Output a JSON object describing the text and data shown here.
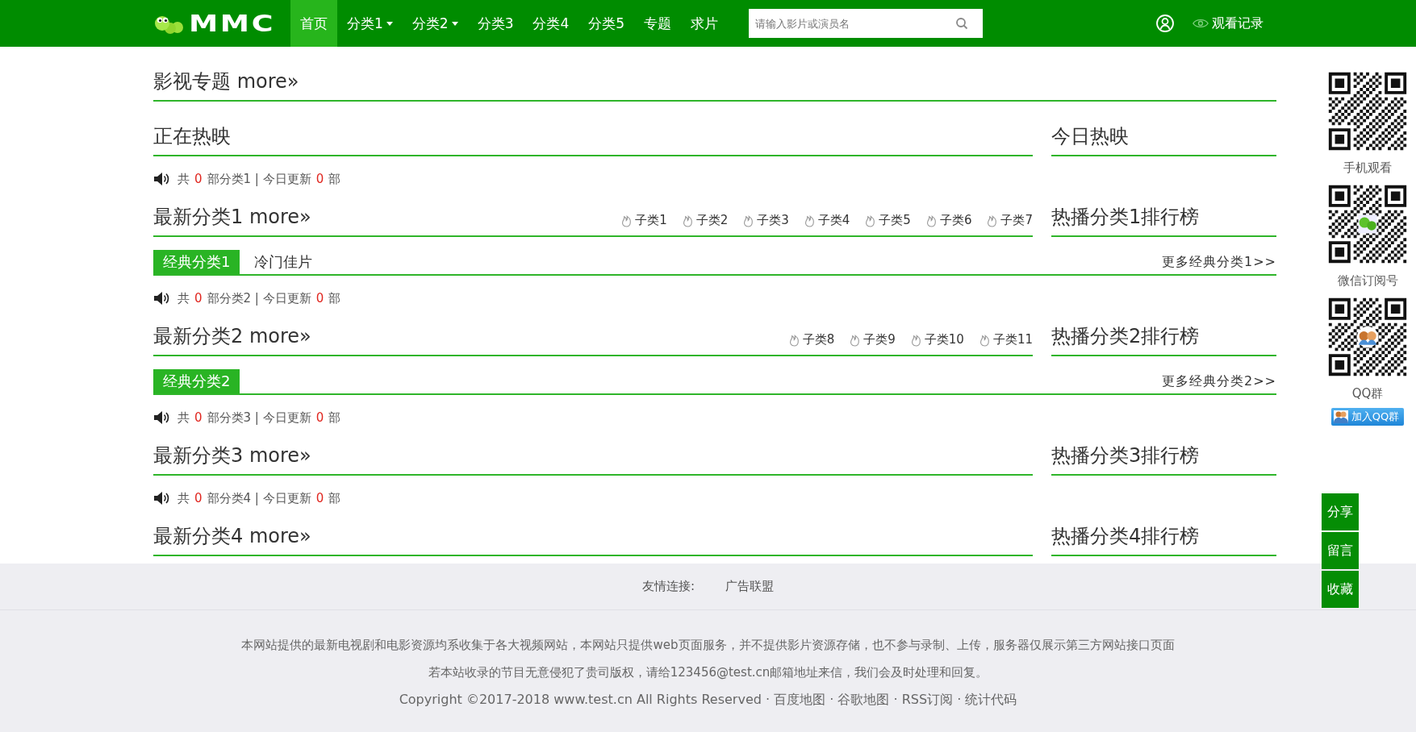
{
  "header": {
    "logo_text": "MMC",
    "nav": [
      {
        "label": "首页",
        "selected": true,
        "dropdown": false
      },
      {
        "label": "分类1",
        "selected": false,
        "dropdown": true
      },
      {
        "label": "分类2",
        "selected": false,
        "dropdown": true
      },
      {
        "label": "分类3",
        "selected": false,
        "dropdown": false
      },
      {
        "label": "分类4",
        "selected": false,
        "dropdown": false
      },
      {
        "label": "分类5",
        "selected": false,
        "dropdown": false
      },
      {
        "label": "专题",
        "selected": false,
        "dropdown": false
      },
      {
        "label": "求片",
        "selected": false,
        "dropdown": false
      }
    ],
    "search": {
      "placeholder": "请输入影片或演员名"
    },
    "history": "观看记录"
  },
  "topic": {
    "title": "影视专题 more»"
  },
  "now_showing": {
    "title": "正在热映",
    "side_title": "今日热映"
  },
  "categories": [
    {
      "stats": [
        {
          "kind": "text",
          "text": "共"
        },
        {
          "kind": "count",
          "text": "0"
        },
        {
          "kind": "text",
          "text": "部分类1 | 今日更新"
        },
        {
          "kind": "count",
          "text": "0"
        },
        {
          "kind": "text",
          "text": "部"
        }
      ],
      "title": "最新分类1 more»",
      "subcategories": [
        "子类1",
        "子类2",
        "子类3",
        "子类4",
        "子类5",
        "子类6",
        "子类7"
      ],
      "ranking_title": "热播分类1排行榜",
      "classic": {
        "tabs": [
          {
            "label": "经典分类1",
            "selected": true
          },
          {
            "label": "冷门佳片",
            "selected": false
          }
        ],
        "more": "更多经典分类1>>"
      }
    },
    {
      "stats": [
        {
          "kind": "text",
          "text": "共"
        },
        {
          "kind": "count",
          "text": "0"
        },
        {
          "kind": "text",
          "text": "部分类2 | 今日更新"
        },
        {
          "kind": "count",
          "text": "0"
        },
        {
          "kind": "text",
          "text": "部"
        }
      ],
      "title": "最新分类2 more»",
      "subcategories": [
        "子类8",
        "子类9",
        "子类10",
        "子类11"
      ],
      "ranking_title": "热播分类2排行榜",
      "classic": {
        "tabs": [
          {
            "label": "经典分类2",
            "selected": true
          }
        ],
        "more": "更多经典分类2>>"
      }
    },
    {
      "stats": [
        {
          "kind": "text",
          "text": "共"
        },
        {
          "kind": "count",
          "text": "0"
        },
        {
          "kind": "text",
          "text": "部分类3 | 今日更新"
        },
        {
          "kind": "count",
          "text": "0"
        },
        {
          "kind": "text",
          "text": "部"
        }
      ],
      "title": "最新分类3 more»",
      "ranking_title": "热播分类3排行榜"
    },
    {
      "stats": [
        {
          "kind": "text",
          "text": "共"
        },
        {
          "kind": "count",
          "text": "0"
        },
        {
          "kind": "text",
          "text": "部分类4 | 今日更新"
        },
        {
          "kind": "count",
          "text": "0"
        },
        {
          "kind": "text",
          "text": "部"
        }
      ],
      "title": "最新分类4 more»",
      "ranking_title": "热播分类4排行榜"
    }
  ],
  "side": {
    "qr_codes": [
      {
        "kind": "plain",
        "caption": "手机观看"
      },
      {
        "kind": "worm",
        "caption": "微信订阅号"
      },
      {
        "kind": "people",
        "caption": "QQ群"
      }
    ],
    "join_button": "加入QQ群",
    "float_buttons": [
      "分享",
      "留言",
      "收藏"
    ]
  },
  "footer": {
    "links_label": "友情连接:",
    "links": [
      "广告联盟"
    ],
    "notice": [
      "本网站提供的最新电视剧和电影资源均系收集于各大视频网站，本网站只提供web页面服务，并不提供影片资源存储，也不参与录制、上传，服务器仅展示第三方网站接口页面",
      "若本站收录的节目无意侵犯了贵司版权，请给123456@test.cn邮箱地址来信，我们会及时处理和回复。"
    ],
    "copyright": "Copyright ©2017-2018 www.test.cn All Rights Reserved · 百度地图 · 谷歌地图 · RSS订阅 · 统计代码"
  }
}
